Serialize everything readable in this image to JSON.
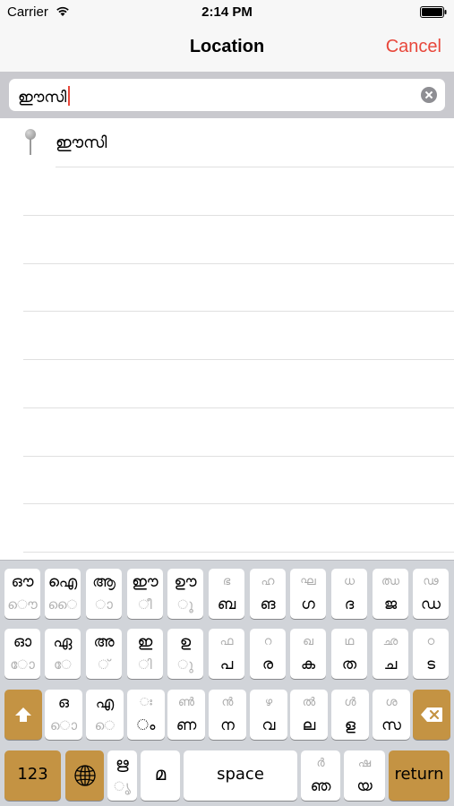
{
  "status": {
    "carrier": "Carrier",
    "time": "2:14 PM"
  },
  "nav": {
    "title": "Location",
    "cancel_label": "Cancel"
  },
  "search": {
    "value": "ഈസി"
  },
  "results": [
    {
      "label": "ഈസി"
    }
  ],
  "colors": {
    "accent": "#e8473b",
    "special_key": "#c49343",
    "keyboard_bg": "#d1d4d9"
  },
  "keyboard": {
    "row1": [
      {
        "top": "ഔ",
        "bot": "ൌ"
      },
      {
        "top": "ഐ",
        "bot": "ൈ"
      },
      {
        "top": "ആ",
        "bot": "ാ"
      },
      {
        "top": "ഈ",
        "bot": "ീ"
      },
      {
        "top": "ഊ",
        "bot": "ൂ"
      },
      {
        "top": "ഭ",
        "bot": "ബ"
      },
      {
        "top": "ഹ",
        "bot": "ങ"
      },
      {
        "top": "ഘ",
        "bot": "ഗ"
      },
      {
        "top": "ധ",
        "bot": "ദ"
      },
      {
        "top": "ഝ",
        "bot": "ജ"
      },
      {
        "top": "ഢ",
        "bot": "ഡ"
      }
    ],
    "row2": [
      {
        "top": "ഓ",
        "bot": "ോ"
      },
      {
        "top": "ഏ",
        "bot": "േ"
      },
      {
        "top": "അ",
        "bot": "്"
      },
      {
        "top": "ഇ",
        "bot": "ി"
      },
      {
        "top": "ഉ",
        "bot": "ു"
      },
      {
        "top": "ഫ",
        "bot": "പ"
      },
      {
        "top": "റ",
        "bot": "ര"
      },
      {
        "top": "ഖ",
        "bot": "ക"
      },
      {
        "top": "ഥ",
        "bot": "ത"
      },
      {
        "top": "ഛ",
        "bot": "ച"
      },
      {
        "top": "ഠ",
        "bot": "ട"
      }
    ],
    "row3": [
      {
        "top": "ഒ",
        "bot": "ൊ"
      },
      {
        "top": "എ",
        "bot": "െ"
      },
      {
        "top": "ഃ",
        "bot": "ം"
      },
      {
        "top": "ൺ",
        "bot": "ണ"
      },
      {
        "top": "ൻ",
        "bot": "ന"
      },
      {
        "top": "ഴ",
        "bot": "വ"
      },
      {
        "top": "ൽ",
        "bot": "ല"
      },
      {
        "top": "ൾ",
        "bot": "ള"
      },
      {
        "top": "ശ",
        "bot": "സ"
      }
    ],
    "row4": {
      "numbers_label": "123",
      "ri_top": "ഋ",
      "ri_bot": "ൃ",
      "ma": "മ",
      "space_label": "space",
      "nja_top": "ർ",
      "nja_bot": "ഞ",
      "ya_top": "ഷ",
      "ya_bot": "യ",
      "return_label": "return"
    }
  }
}
